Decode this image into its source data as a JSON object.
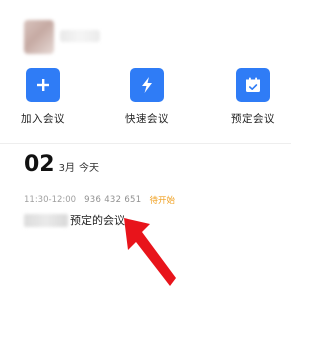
{
  "actions": [
    {
      "label": "加入会议",
      "icon": "plus-icon"
    },
    {
      "label": "快速会议",
      "icon": "lightning-icon"
    },
    {
      "label": "预定会议",
      "icon": "calendar-icon"
    }
  ],
  "date": {
    "day": "02",
    "month": "3月",
    "today": "今天"
  },
  "meeting": {
    "time": "11:30-12:00",
    "id": "936 432 651",
    "status": "待开始",
    "title": "预定的会议"
  },
  "colors": {
    "accent": "#2f7cf6",
    "status": "#f0a020",
    "arrow": "#e8141b"
  }
}
